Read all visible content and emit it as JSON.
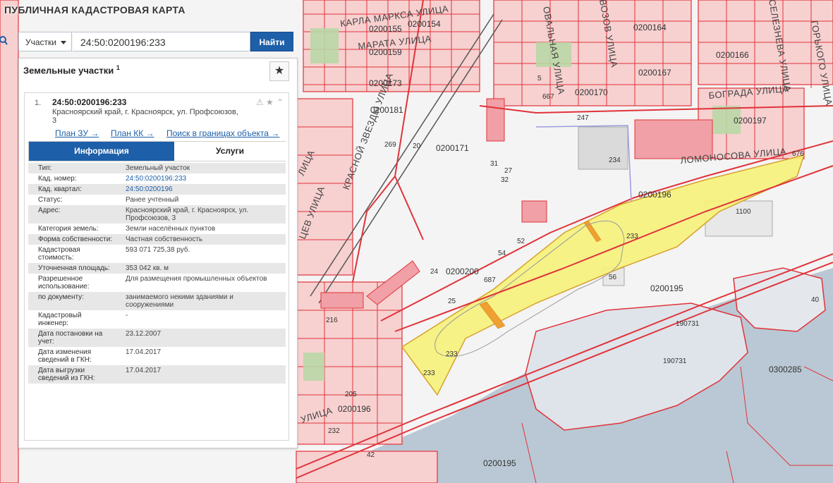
{
  "app": {
    "title": "ПУБЛИЧНАЯ КАДАСТРОВАЯ КАРТА"
  },
  "search": {
    "type_select": "Участки",
    "value": "24:50:0200196:233",
    "clear_icon": "close-icon",
    "button": "Найти"
  },
  "panel": {
    "section_title": "Земельные участки",
    "section_count": "1",
    "result": {
      "number": "1.",
      "cad_number": "24:50:0200196:233",
      "address_line1": "Красноярский край, г. Красноярск, ул. Профсоюзов,",
      "address_line2": "3",
      "links": [
        "План ЗУ →",
        "План КК →",
        "Поиск в границах объекта →"
      ],
      "tabs": [
        "Информация",
        "Услуги"
      ],
      "attributes": [
        {
          "key": "Тип:",
          "value": "Земельный участок"
        },
        {
          "key": "Кад. номер:",
          "value": "24:50:0200196:233",
          "link": true
        },
        {
          "key": "Кад. квартал:",
          "value": "24:50:0200196",
          "link": true
        },
        {
          "key": "Статус:",
          "value": "Ранее учтенный"
        },
        {
          "key": "Адрес:",
          "value": "Красноярский край, г. Красноярск, ул. Профсоюзов, 3"
        },
        {
          "key": "Категория земель:",
          "value": "Земли населённых пунктов"
        },
        {
          "key": "Форма собственности:",
          "value": "Частная собственность"
        },
        {
          "key": "Кадастровая стоимость:",
          "value": "593 071 725,38 руб."
        },
        {
          "key": "Уточненная площадь:",
          "value": "353 042 кв. м"
        },
        {
          "key": "Разрешенное использование:",
          "value": "Для размещения промышленных объектов"
        },
        {
          "key": "по документу:",
          "value": "занимаемого некими зданиями и сооружениями"
        },
        {
          "key": "Кадастровый инженер:",
          "value": "-"
        },
        {
          "key": "Дата постановки на учет:",
          "value": "23.12.2007"
        },
        {
          "key": "Дата изменения сведений в ГКН:",
          "value": "17.04.2017"
        },
        {
          "key": "Дата выгрузки сведений из ГКН:",
          "value": "17.04.2017"
        }
      ]
    }
  },
  "map": {
    "colors": {
      "parcel_outline": "#e0333a",
      "parcel_fill": "#f7d0d0",
      "selected_fill": "#f6f27a",
      "water": "#b9c8d4",
      "green": "#b9d7a6",
      "land": "#f4f4f4"
    },
    "streets": [
      {
        "name": "КАРЛА МАРКСА УЛИЦА"
      },
      {
        "name": "МАРАТА УЛИЦА"
      },
      {
        "name": "КРАСНОЙ ЗВЕЗДЫ УЛИЦА"
      },
      {
        "name": "БОГРАДА УЛИЦА"
      },
      {
        "name": "ЛОМОНОСОВА УЛИЦА"
      },
      {
        "name": "ОВАЛЬНАЯ УЛИЦА"
      },
      {
        "name": "ВОЗОВ УЛИЦА"
      },
      {
        "name": "ГОРЬКОГО УЛИЦА"
      },
      {
        "name": "СЕЛЕЗНЕВА УЛИЦА"
      },
      {
        "name": "УЛИЦА"
      },
      {
        "name": "ЦЕВ УЛИЦА"
      },
      {
        "name": "ЛИЦА"
      }
    ],
    "quarters": [
      "0200164",
      "0200166",
      "0200167",
      "0200170",
      "0200171",
      "0200173",
      "0200181",
      "0200159",
      "0200155",
      "0200154",
      "0200197",
      "0200196",
      "0200195",
      "0200200",
      "0300285",
      "0200195",
      "0200196"
    ],
    "parcel_numbers": [
      "233",
      "233",
      "233",
      "234",
      "1100",
      "247",
      "56",
      "24",
      "52",
      "54",
      "25",
      "27",
      "31",
      "32",
      "216",
      "205",
      "232",
      "42",
      "190731",
      "190731",
      "269",
      "20",
      "687",
      "667",
      "676",
      "5",
      "40"
    ]
  }
}
